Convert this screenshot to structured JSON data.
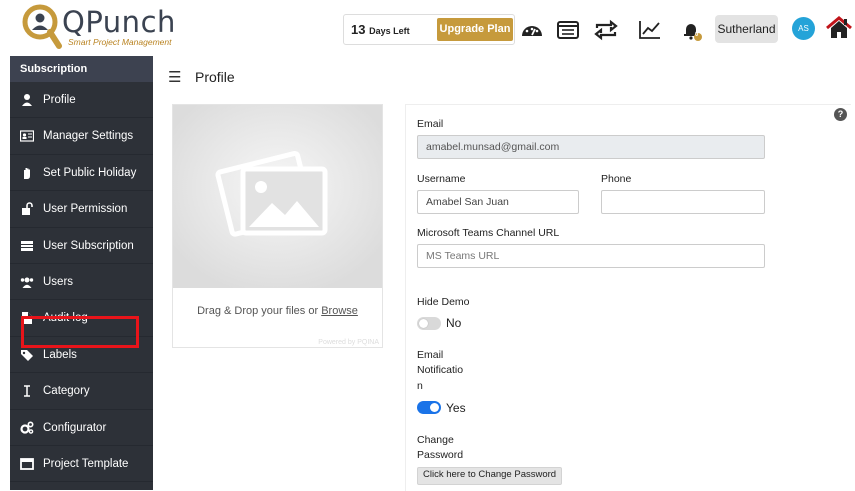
{
  "header": {
    "brand": "QPunch",
    "tagline": "Smart Project Management",
    "days_left_number": "13",
    "days_left_text": "Days Left",
    "upgrade_label": "Upgrade Plan",
    "user_name": "Sutherland",
    "avatar_initials": "AS",
    "icons": [
      "dashboard-icon",
      "calendar-list-icon",
      "sync-icon",
      "chart-icon",
      "notification-bell-icon",
      "home-icon"
    ],
    "bell_badge": "0"
  },
  "sidebar": {
    "section_title": "Subscription",
    "items": [
      {
        "label": "Profile",
        "icon": "user-icon"
      },
      {
        "label": "Manager Settings",
        "icon": "id-card-icon"
      },
      {
        "label": "Set Public Holiday",
        "icon": "hand-icon"
      },
      {
        "label": "User Permission",
        "icon": "unlock-icon"
      },
      {
        "label": "User Subscription",
        "icon": "list-icon"
      },
      {
        "label": "Users",
        "icon": "users-icon"
      },
      {
        "label": "Audit log",
        "icon": "file-icon"
      },
      {
        "label": "Labels",
        "icon": "tags-icon"
      },
      {
        "label": "Category",
        "icon": "text-cursor-icon"
      },
      {
        "label": "Configurator",
        "icon": "cogs-icon"
      },
      {
        "label": "Project Template",
        "icon": "window-icon"
      }
    ],
    "highlighted_item": "Users",
    "highlight_color": "#e8141a"
  },
  "main": {
    "page_title": "Profile",
    "dropzone": {
      "text_before": "Drag & Drop your files or ",
      "browse_link": "Browse",
      "powered_by": "Powered by PQINA"
    },
    "form": {
      "email_label": "Email",
      "email_value": "amabel.munsad@gmail.com",
      "username_label": "Username",
      "username_value": "Amabel San Juan",
      "phone_label": "Phone",
      "phone_value": "",
      "teams_label": "Microsoft Teams Channel URL",
      "teams_placeholder": "MS Teams URL",
      "hide_demo_label": "Hide Demo",
      "hide_demo_value": "No",
      "email_notif_label_1": "Email",
      "email_notif_label_2": "Notificatio",
      "email_notif_label_3": "n",
      "email_notif_value": "Yes",
      "change_pwd_label_1": "Change",
      "change_pwd_label_2": "Password",
      "change_pwd_button": "Click here to Change Password"
    }
  },
  "colors": {
    "sidebar_bg": "#2d3138",
    "accent_gold": "#c69a3c",
    "toggle_on": "#1a73e8",
    "avatar": "#24a3d8"
  }
}
